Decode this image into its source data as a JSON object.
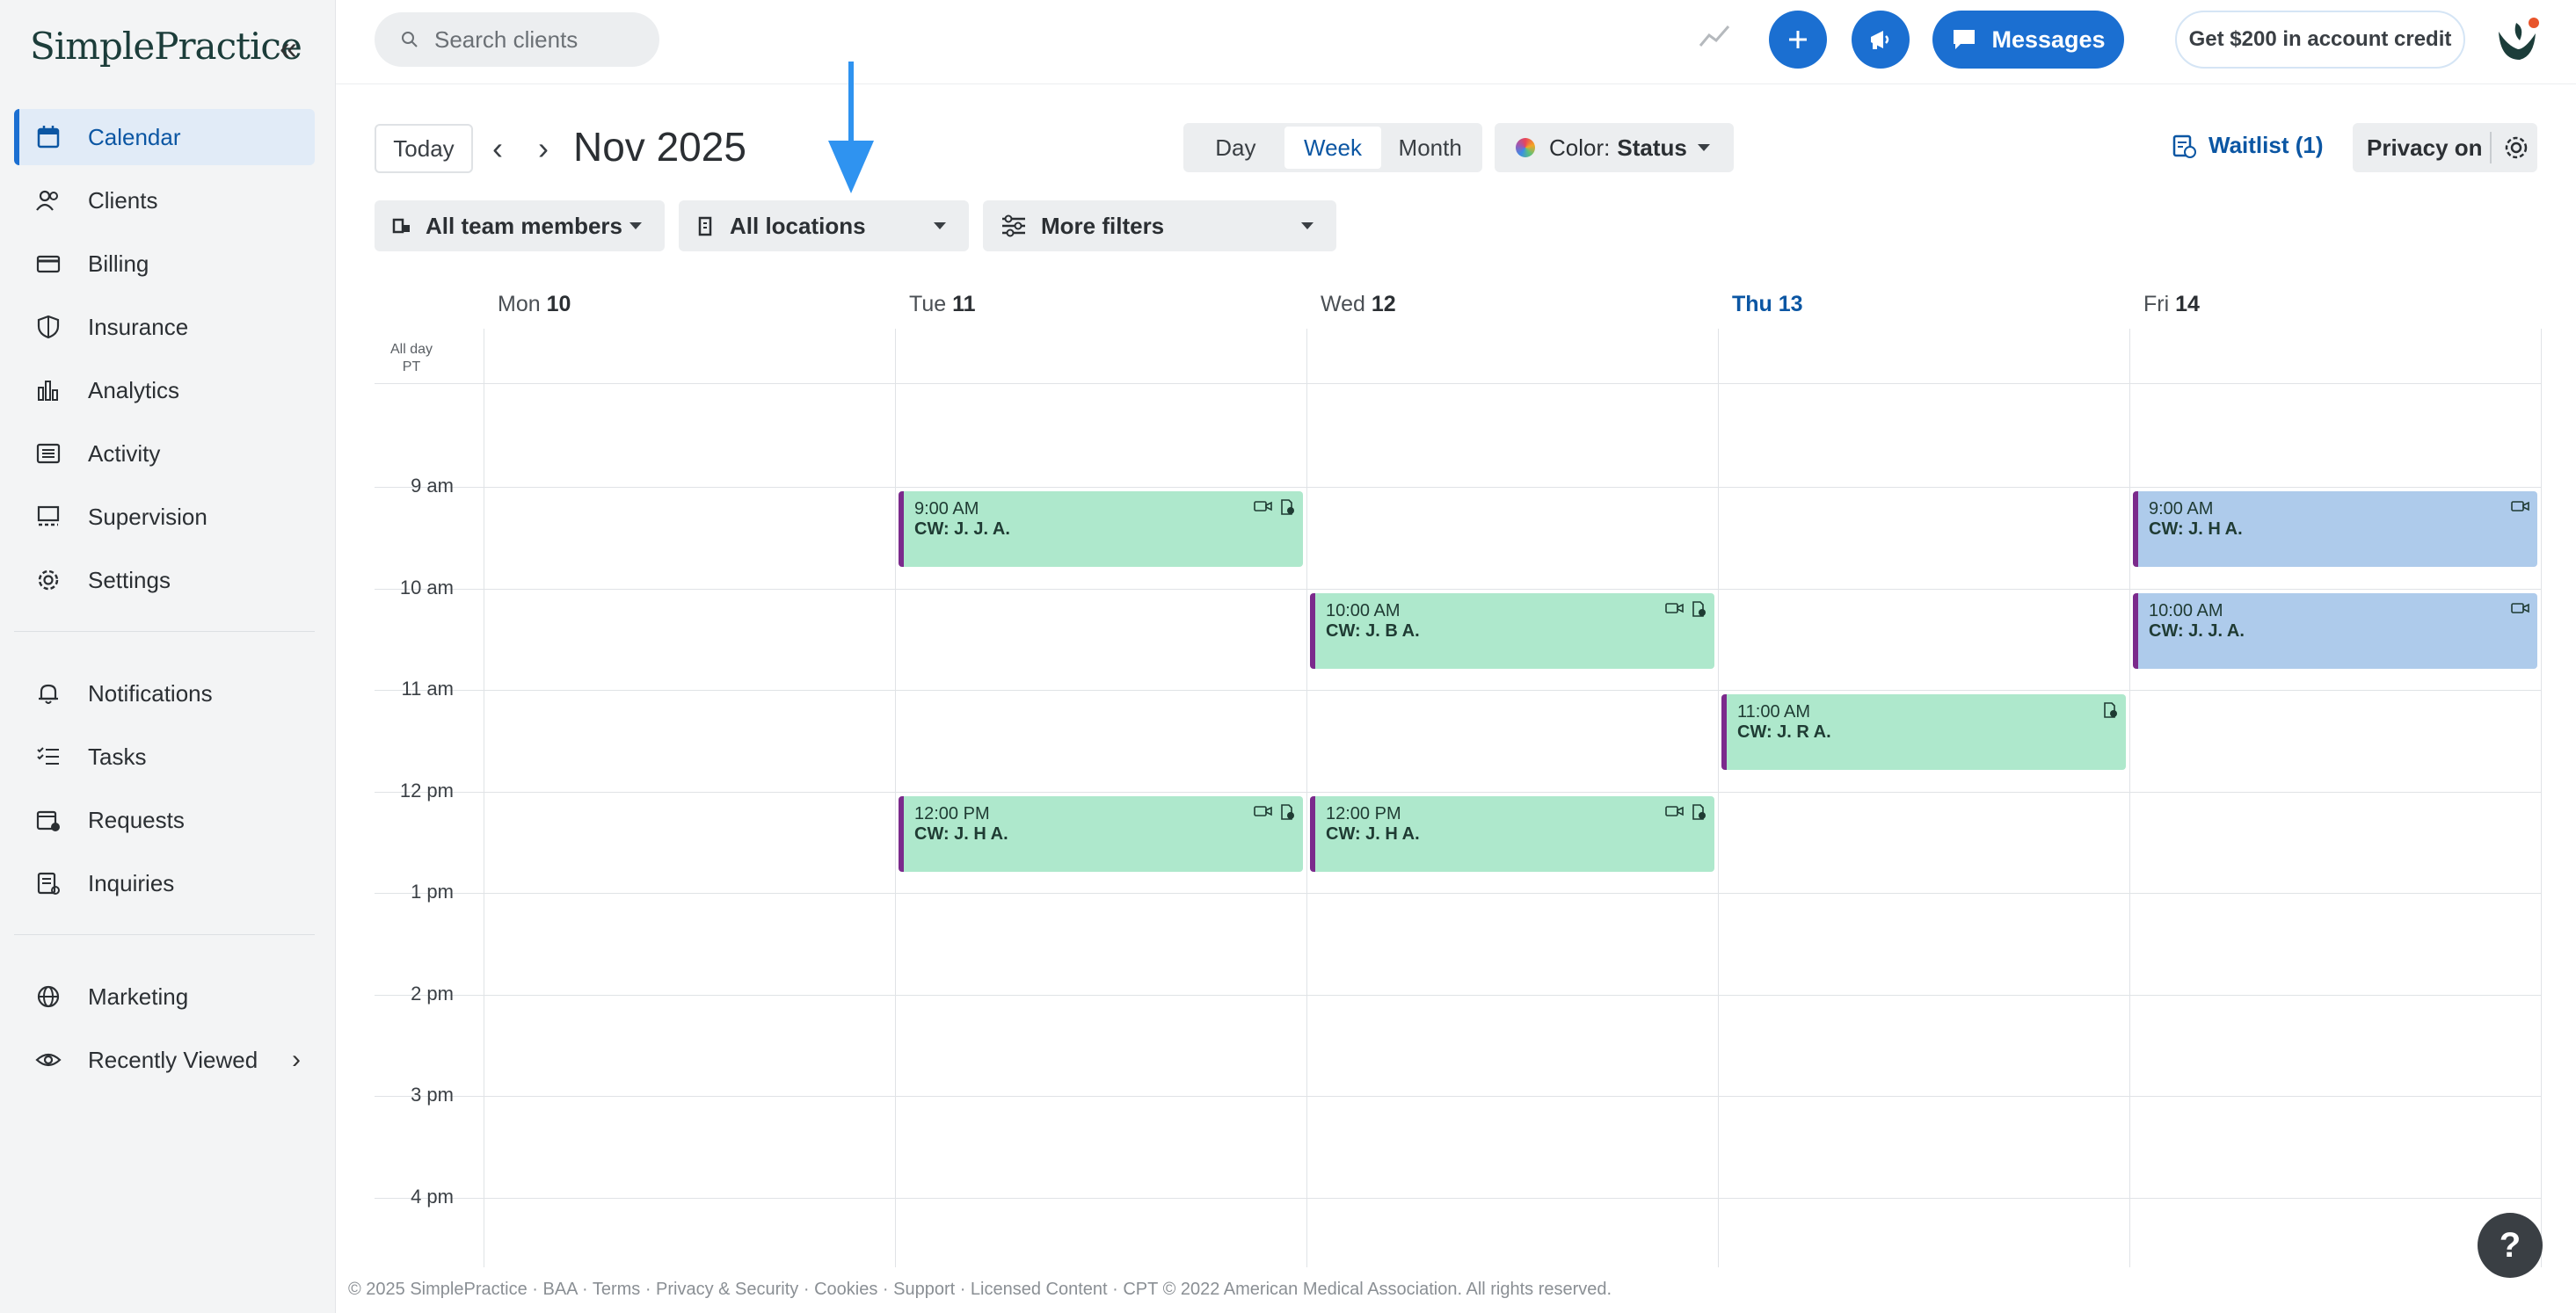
{
  "brand": {
    "logo_text": "SimplePractice"
  },
  "sidebar": {
    "items": [
      {
        "label": "Calendar",
        "icon": "calendar-icon",
        "active": true
      },
      {
        "label": "Clients",
        "icon": "clients-icon"
      },
      {
        "label": "Billing",
        "icon": "billing-icon"
      },
      {
        "label": "Insurance",
        "icon": "shield-icon"
      },
      {
        "label": "Analytics",
        "icon": "bar-chart-icon"
      },
      {
        "label": "Activity",
        "icon": "list-icon"
      },
      {
        "label": "Supervision",
        "icon": "supervision-icon"
      },
      {
        "label": "Settings",
        "icon": "gear-icon"
      },
      {
        "label": "Notifications",
        "icon": "bell-icon"
      },
      {
        "label": "Tasks",
        "icon": "tasks-icon"
      },
      {
        "label": "Requests",
        "icon": "calendar-plus-icon"
      },
      {
        "label": "Inquiries",
        "icon": "inquiry-icon"
      },
      {
        "label": "Marketing",
        "icon": "globe-icon"
      },
      {
        "label": "Recently Viewed",
        "icon": "eye-icon"
      }
    ]
  },
  "topbar": {
    "search_placeholder": "Search clients",
    "messages_label": "Messages",
    "credit_label": "Get $200 in account credit"
  },
  "toolbar": {
    "today_label": "Today",
    "month_title": "Nov 2025",
    "views": [
      "Day",
      "Week",
      "Month"
    ],
    "active_view": "Week",
    "color_prefix": "Color:",
    "color_value": "Status",
    "waitlist_label": "Waitlist (1)",
    "privacy_label": "Privacy on"
  },
  "filters": {
    "team": "All team members",
    "locations": "All locations",
    "more": "More filters"
  },
  "calendar": {
    "allday_label": "All day",
    "timezone": "PT",
    "days": [
      {
        "name": "Mon",
        "num": "10"
      },
      {
        "name": "Tue",
        "num": "11"
      },
      {
        "name": "Wed",
        "num": "12"
      },
      {
        "name": "Thu",
        "num": "13",
        "today": true
      },
      {
        "name": "Fri",
        "num": "14"
      }
    ],
    "hours": [
      "9 am",
      "10 am",
      "11 am",
      "12 pm",
      "1 pm",
      "2 pm",
      "3 pm",
      "4 pm"
    ],
    "events": [
      {
        "day": 1,
        "hour": 0,
        "time": "9:00 AM",
        "who": "CW: J. J. A.",
        "color": "green",
        "icons": [
          "video-icon",
          "clinic-icon"
        ]
      },
      {
        "day": 2,
        "hour": 1,
        "time": "10:00 AM",
        "who": "CW: J. B A.",
        "color": "green",
        "icons": [
          "video-icon",
          "clinic-icon"
        ]
      },
      {
        "day": 3,
        "hour": 2,
        "time": "11:00 AM",
        "who": "CW: J. R A.",
        "color": "green",
        "icons": [
          "clinic-icon"
        ]
      },
      {
        "day": 1,
        "hour": 3,
        "time": "12:00 PM",
        "who": "CW: J. H A.",
        "color": "green",
        "icons": [
          "video-icon",
          "clinic-icon"
        ]
      },
      {
        "day": 2,
        "hour": 3,
        "time": "12:00 PM",
        "who": "CW: J. H A.",
        "color": "green",
        "icons": [
          "video-icon",
          "clinic-icon"
        ]
      },
      {
        "day": 4,
        "hour": 0,
        "time": "9:00 AM",
        "who": "CW: J. H A.",
        "color": "blue",
        "icons": [
          "video-icon"
        ]
      },
      {
        "day": 4,
        "hour": 1,
        "time": "10:00 AM",
        "who": "CW: J. J. A.",
        "color": "blue",
        "icons": [
          "video-icon"
        ]
      }
    ]
  },
  "footer": {
    "text": "© 2025 SimplePractice · BAA · Terms · Privacy & Security · Cookies · Support · Licensed Content · CPT © 2022 American Medical Association. All rights reserved."
  },
  "help_label": "?",
  "colors": {
    "accent": "#1b6fd1",
    "event_green": "#aee8cc",
    "event_blue": "#aecbeb",
    "event_border": "#7b2a8c"
  }
}
